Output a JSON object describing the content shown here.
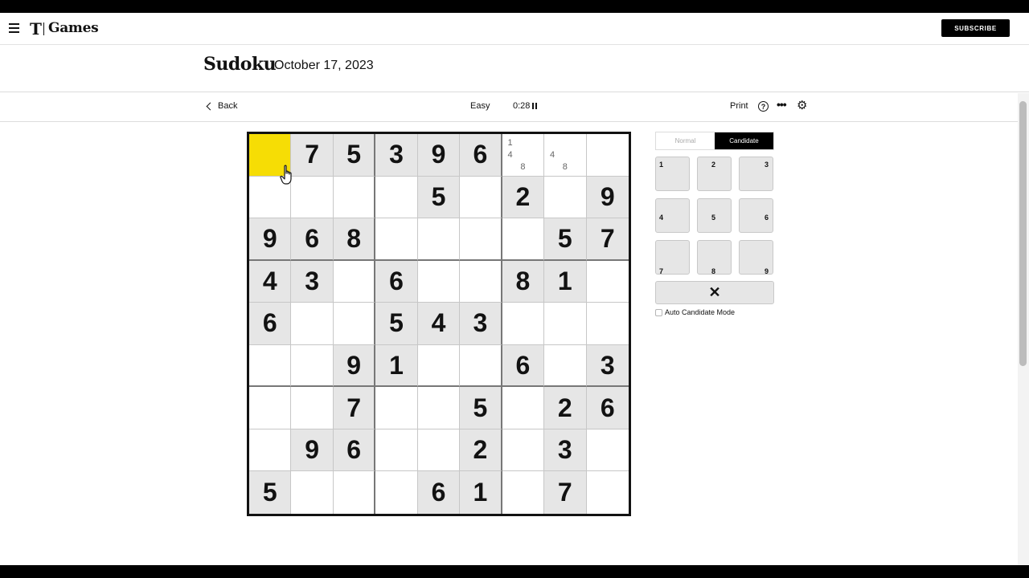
{
  "header": {
    "logo_mark": "T",
    "brand": "Games",
    "subscribe_label": "SUBSCRIBE"
  },
  "page": {
    "title": "Sudoku",
    "date": "October 17, 2023"
  },
  "toolbar": {
    "back_label": "Back",
    "difficulty": "Easy",
    "timer": "0:28",
    "print_label": "Print",
    "help_glyph": "?",
    "more_glyph": "•••",
    "settings_glyph": "⚙"
  },
  "board": {
    "selected": [
      0,
      0
    ],
    "rows": [
      [
        "",
        "7",
        "5",
        "3",
        "9",
        "6",
        "",
        "",
        ""
      ],
      [
        "",
        "",
        "",
        "",
        "5",
        "",
        "2",
        "",
        "9"
      ],
      [
        "9",
        "6",
        "8",
        "",
        "",
        "",
        "",
        "5",
        "7"
      ],
      [
        "4",
        "3",
        "",
        "6",
        "",
        "",
        "8",
        "1",
        ""
      ],
      [
        "6",
        "",
        "",
        "5",
        "4",
        "3",
        "",
        "",
        ""
      ],
      [
        "",
        "",
        "9",
        "1",
        "",
        "",
        "6",
        "",
        "3"
      ],
      [
        "",
        "",
        "7",
        "",
        "",
        "5",
        "",
        "2",
        "6"
      ],
      [
        "",
        "9",
        "6",
        "",
        "",
        "2",
        "",
        "3",
        ""
      ],
      [
        "5",
        "",
        "",
        "",
        "6",
        "1",
        "",
        "7",
        ""
      ]
    ],
    "candidates": {
      "0-6": [
        "1",
        "",
        "",
        "4",
        "",
        "",
        "",
        "8",
        ""
      ],
      "0-7": [
        "",
        "",
        "",
        "4",
        "",
        "",
        "",
        "8",
        ""
      ]
    }
  },
  "controls": {
    "mode_normal": "Normal",
    "mode_candidate": "Candidate",
    "active_mode": "candidate",
    "keys": [
      "1",
      "2",
      "3",
      "4",
      "5",
      "6",
      "7",
      "8",
      "9"
    ],
    "erase_glyph": "✕",
    "auto_candidate_label": "Auto Candidate Mode",
    "auto_candidate_checked": false
  }
}
